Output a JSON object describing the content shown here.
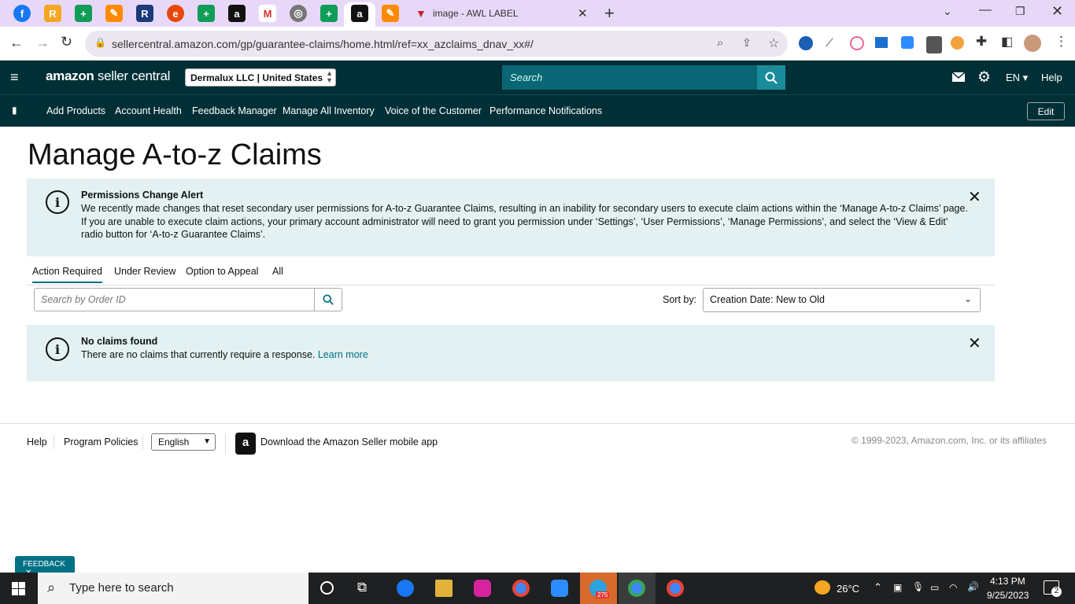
{
  "browser": {
    "active_tab_title": "image - AWL LABEL",
    "url": "sellercentral.amazon.com/gp/guarantee-claims/home.html/ref=xx_azclaims_dnav_xx#/"
  },
  "header": {
    "logo_main": "amazon",
    "logo_sub": " seller central",
    "account": "Dermalux LLC | United States",
    "search_placeholder": "Search",
    "language": "EN",
    "help": "Help"
  },
  "nav": {
    "items": [
      "Add Products",
      "Account Health",
      "Feedback Manager",
      "Manage All Inventory",
      "Voice of the Customer",
      "Performance Notifications"
    ],
    "edit": "Edit"
  },
  "page": {
    "title": "Manage A-to-z Claims",
    "alert": {
      "title": "Permissions Change Alert",
      "body": "We recently made changes that reset secondary user permissions for A-to-z Guarantee Claims, resulting in an inability for secondary users to execute claim actions within the ‘Manage A-to-z Claims’ page. If you are unable to execute claim actions, your primary account administrator will need to grant you permission under ‘Settings’, ‘User Permissions’, ‘Manage Permissions’, and select the ‘View & Edit’ radio button for ‘A-to-z Guarantee Claims’."
    },
    "tabs": [
      "Action Required",
      "Under Review",
      "Option to Appeal",
      "All"
    ],
    "search_placeholder": "Search by Order ID",
    "sort_label": "Sort by:",
    "sort_value": "Creation Date: New to Old",
    "empty": {
      "title": "No claims found",
      "body": "There are no claims that currently require a response. ",
      "link": "Learn more"
    }
  },
  "footer": {
    "help": "Help",
    "policies": "Program Policies",
    "language": "English",
    "app": "Download the Amazon Seller mobile app",
    "copyright": "© 1999-2023, Amazon.com, Inc. or its affiliates",
    "feedback": "FEEDBACK"
  },
  "taskbar": {
    "search": "Type here to search",
    "telegram_badge": "275",
    "weather": "26°C",
    "time": "4:13 PM",
    "date": "9/25/2023",
    "notifications": "2"
  },
  "colors": {
    "header_bg": "#002f36",
    "alert_bg": "#e3f1f2",
    "link": "#007185",
    "tab_underline": "#007185"
  }
}
